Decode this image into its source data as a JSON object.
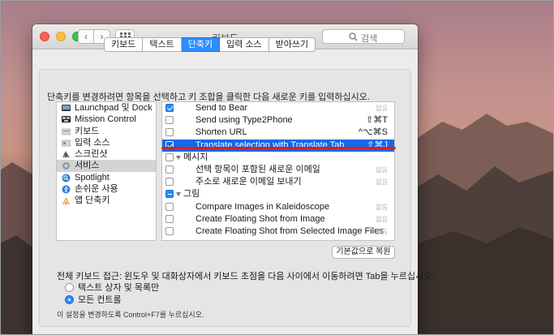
{
  "window": {
    "title": "키보드"
  },
  "toolbar": {
    "search_placeholder": "검색",
    "back_glyph": "‹",
    "forward_glyph": "›"
  },
  "tabs": [
    {
      "label": "키보드",
      "active": false
    },
    {
      "label": "텍스트",
      "active": false
    },
    {
      "label": "단축키",
      "active": true
    },
    {
      "label": "입력 소스",
      "active": false
    },
    {
      "label": "받아쓰기",
      "active": false
    }
  ],
  "instruction": "단축키를 변경하려면 항목을 선택하고 키 조합을 클릭한 다음 새로운 키를 입력하십시오.",
  "categories": [
    {
      "label": "Launchpad 및 Dock",
      "icon": "launchpad-icon",
      "selected": false
    },
    {
      "label": "Mission Control",
      "icon": "mission-control-icon",
      "selected": false
    },
    {
      "label": "키보드",
      "icon": "keyboard-icon",
      "selected": false
    },
    {
      "label": "입력 소스",
      "icon": "input-source-icon",
      "selected": false
    },
    {
      "label": "스크린샷",
      "icon": "screenshot-icon",
      "selected": false
    },
    {
      "label": "서비스",
      "icon": "services-gear-icon",
      "selected": true
    },
    {
      "label": "Spotlight",
      "icon": "spotlight-icon",
      "selected": false
    },
    {
      "label": "손쉬운 사용",
      "icon": "accessibility-icon",
      "selected": false
    },
    {
      "label": "앱 단축키",
      "icon": "app-shortcuts-icon",
      "selected": false
    }
  ],
  "shortcuts": [
    {
      "label": "Send to Bear",
      "key": "없음",
      "checkbox": "checked",
      "type": "item"
    },
    {
      "label": "Send using Type2Phone",
      "key": "⇧⌘T",
      "checkbox": "unchecked",
      "type": "item"
    },
    {
      "label": "Shorten URL",
      "key": "^⌥⌘S",
      "checkbox": "unchecked",
      "type": "item"
    },
    {
      "label": "Translate selection with Translate Tab",
      "key": "⇧⌘J",
      "checkbox": "checked",
      "type": "item",
      "selected": true
    },
    {
      "label": "메시지",
      "key": "",
      "checkbox": "unchecked",
      "type": "group"
    },
    {
      "label": "선택 항목이 포함된 새로운 이메일",
      "key": "없음",
      "checkbox": "unchecked",
      "type": "item"
    },
    {
      "label": "주소로 새로운 이메일 보내기",
      "key": "없음",
      "checkbox": "unchecked",
      "type": "item"
    },
    {
      "label": "그림",
      "key": "",
      "checkbox": "mixed",
      "type": "group"
    },
    {
      "label": "Compare Images in Kaleidoscope",
      "key": "없음",
      "checkbox": "unchecked",
      "type": "item"
    },
    {
      "label": "Create Floating Shot from Image",
      "key": "없음",
      "checkbox": "unchecked",
      "type": "item"
    },
    {
      "label": "Create Floating Shot from Selected Image Files",
      "key": "없음",
      "checkbox": "unchecked",
      "type": "item"
    }
  ],
  "restore_button": "기본값으로 복원",
  "full_keyboard_access": "전체 키보드 접근: 윈도우 및 대화상자에서 키보드 초점을 다음 사이에서 이동하려면 Tab을 누르십시오.",
  "radio_options": [
    {
      "label": "텍스트 상자 및 목록만",
      "selected": false
    },
    {
      "label": "모든 컨트롤",
      "selected": true
    }
  ],
  "note": "이 설정을 변경하도록 Control+F7를 누르십시오.",
  "colors": {
    "accent": "#2d8cff",
    "selection": "#1168ea",
    "annotation": "#d8201e"
  }
}
